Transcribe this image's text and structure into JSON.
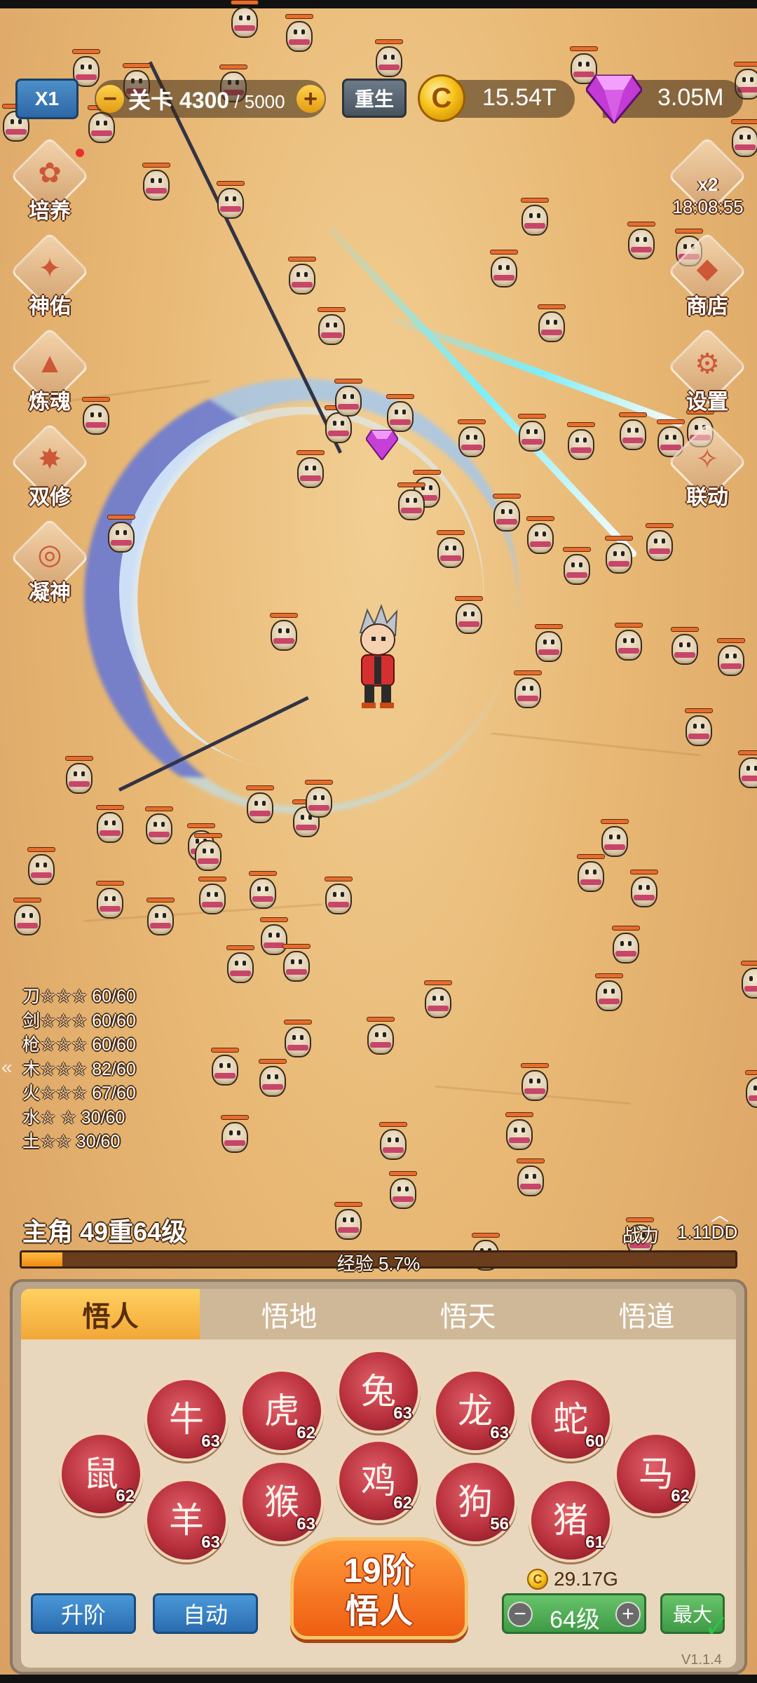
{
  "hud": {
    "speed": "X1",
    "stage_label": "关卡",
    "stage_current": "4300",
    "stage_sep": " / ",
    "stage_total": "5000",
    "stage_minus": "−",
    "stage_plus": "+",
    "rebirth": "重生",
    "coin_symbol": "C",
    "coins": "15.54T",
    "gems": "3.05M"
  },
  "left_menu": [
    {
      "label": "培养",
      "icon": "cultivate-icon"
    },
    {
      "label": "神佑",
      "icon": "blessing-icon"
    },
    {
      "label": "炼魂",
      "icon": "soul-refine-icon"
    },
    {
      "label": "双修",
      "icon": "dual-cultivation-icon"
    },
    {
      "label": "凝神",
      "icon": "focus-icon"
    }
  ],
  "right_menu": {
    "boost": "x2",
    "timer": "18:08:55",
    "items": [
      {
        "label": "商店",
        "icon": "shop-icon"
      },
      {
        "label": "设置",
        "icon": "settings-icon"
      },
      {
        "label": "联动",
        "icon": "collab-icon"
      }
    ]
  },
  "weapon_stats": [
    {
      "name": "刀",
      "stars": "☆☆☆",
      "value": "60/60"
    },
    {
      "name": "剑",
      "stars": "☆☆☆",
      "value": "60/60"
    },
    {
      "name": "枪",
      "stars": "☆☆☆",
      "value": "60/60"
    },
    {
      "name": "木",
      "stars": "☆☆☆",
      "value": "82/60"
    },
    {
      "name": "火",
      "stars": "☆☆☆",
      "value": "67/60"
    },
    {
      "name": "水",
      "stars": "☆ ☆",
      "value": "30/60"
    },
    {
      "name": "土",
      "stars": "☆☆",
      "value": "30/60"
    }
  ],
  "character": {
    "name": "主角 49重64级",
    "power_label": "战力",
    "power_value": "1.11DD",
    "exp_text": "经验 5.7%",
    "exp_fraction": 0.057
  },
  "tabs": [
    {
      "label": "悟人",
      "active": true
    },
    {
      "label": "悟地",
      "active": false
    },
    {
      "label": "悟天",
      "active": false
    },
    {
      "label": "悟道",
      "active": false
    }
  ],
  "zodiac": [
    {
      "name": "rat",
      "glyph": "鼠",
      "level": "62"
    },
    {
      "name": "ox",
      "glyph": "牛",
      "level": "63"
    },
    {
      "name": "tiger",
      "glyph": "虎",
      "level": "62"
    },
    {
      "name": "rabbit",
      "glyph": "兔",
      "level": "63"
    },
    {
      "name": "dragon",
      "glyph": "龙",
      "level": "63"
    },
    {
      "name": "snake",
      "glyph": "蛇",
      "level": "60"
    },
    {
      "name": "horse",
      "glyph": "马",
      "level": "62"
    },
    {
      "name": "goat",
      "glyph": "羊",
      "level": "63"
    },
    {
      "name": "monkey",
      "glyph": "猴",
      "level": "63"
    },
    {
      "name": "rooster",
      "glyph": "鸡",
      "level": "62"
    },
    {
      "name": "dog",
      "glyph": "狗",
      "level": "56"
    },
    {
      "name": "pig",
      "glyph": "猪",
      "level": "61"
    }
  ],
  "bottom": {
    "upgrade": "升阶",
    "auto": "自动",
    "main_line1": "19阶",
    "main_line2": "悟人",
    "cost": "29.17G",
    "level_minus": "−",
    "level": "64级",
    "level_plus": "+",
    "max": "最大",
    "version": "V1.1.4"
  },
  "colors": {
    "sand": "#e8b874",
    "accent_orange": "#ee5e12",
    "button_blue": "#2a6cb0",
    "button_green": "#3e9a45",
    "zodiac_red": "#b8303c"
  }
}
